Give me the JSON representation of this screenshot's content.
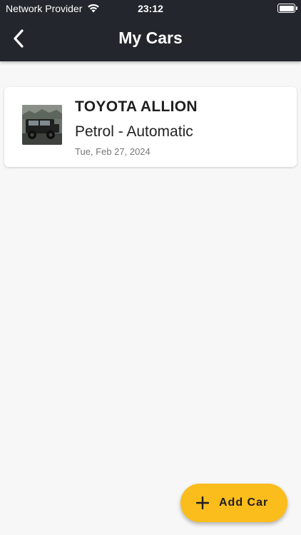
{
  "status_bar": {
    "carrier": "Network Provider",
    "time": "23:12",
    "wifi_icon": "wifi-icon",
    "battery_icon": "battery-icon"
  },
  "app_bar": {
    "back_icon": "chevron-left-icon",
    "title": "My Cars",
    "background_color": "#23272d"
  },
  "cars": [
    {
      "name": "TOYOTA ALLION",
      "spec": "Petrol - Automatic",
      "date": "Tue, Feb 27, 2024"
    }
  ],
  "fab": {
    "icon": "plus-icon",
    "label": "Add Car",
    "color": "#fbbd1b"
  }
}
